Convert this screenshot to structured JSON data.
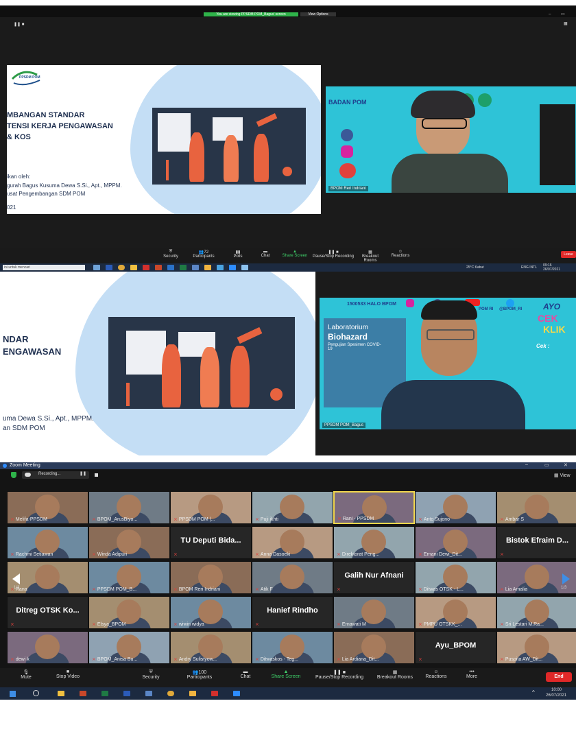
{
  "panel1": {
    "viewing_banner": "You are viewing PPSDM POM_Bagus' screen",
    "view_options": "View Options",
    "slide": {
      "logo_text": "PPSDM POM",
      "title_lines": [
        "MBANGAN STANDAR",
        "TENSI KERJA PENGAWASAN",
        "& KOS"
      ],
      "presented_by": "ikan oleh:",
      "presenter_line1": "gurah Bagus Kusuma Dewa S.Si., Apt., MPPM.",
      "presenter_line2": "usat Pengembangan SDM POM",
      "year": "021"
    },
    "speaker": {
      "name": "BPOM Reri Indriani",
      "banner_label": "BADAN POM"
    },
    "toolbar": {
      "participants_count": "72",
      "items": [
        "Security",
        "Participants",
        "Polls",
        "Chat",
        "Share Screen",
        "Pause/Stop Recording",
        "Breakout Rooms",
        "Reactions"
      ],
      "leave": "Leave"
    },
    "taskbar": {
      "search": "ini untuk mencari",
      "weather": "25°C Kabut",
      "lang": "ENG INTL",
      "time": "09:16",
      "date": "26/07/2021"
    }
  },
  "panel2": {
    "slide": {
      "title_lines": [
        "NDAR",
        "ENGAWASAN"
      ],
      "presenter_line1": "uma Dewa S.Si., Apt., MPPM.",
      "presenter_line2": "an SDM POM"
    },
    "speaker": {
      "name": "PPSDM POM_Bagus",
      "halo_label": "1500533 HALO BPOM",
      "lab_title": "Laboratorium",
      "lab_title2": "Biohazard",
      "lab_sub": "Pengujian Spesimen COVID-19",
      "social": "POM RI",
      "social2": "@BPOM_RI",
      "ayo": "AYO",
      "cek": "CEK",
      "klik": "KLIK",
      "cek_list_header": "Cek :"
    }
  },
  "panel3": {
    "window_title": "Zoom Meeting",
    "recording": "Recording...",
    "view_label": "View",
    "page_left": "1/3",
    "page_right": "1/3",
    "tiles": [
      {
        "name": "Melifa-PPSDM",
        "type": "photo"
      },
      {
        "name": "BPOM_ArusBiyo...",
        "type": "photo"
      },
      {
        "name": "PPSDM POM |...",
        "type": "photo"
      },
      {
        "name": "Puji ikhti",
        "type": "photo"
      },
      {
        "name": "Rani - PPSDM",
        "type": "photo",
        "active": true
      },
      {
        "name": "Anto Sujono",
        "type": "photo"
      },
      {
        "name": "Ambar S",
        "type": "photo"
      },
      {
        "name": "Rachmi Setiawan",
        "type": "photo"
      },
      {
        "name": "Winda Adipuri",
        "type": "photo"
      },
      {
        "name": "TU Deputi Bida...",
        "type": "name"
      },
      {
        "name": "Anna Dasoeki",
        "type": "photo"
      },
      {
        "name": "Direktorat Peng...",
        "type": "photo"
      },
      {
        "name": "Ernani Dewi_Dit...",
        "type": "photo"
      },
      {
        "name": "Bistok Efraim D...",
        "type": "name"
      },
      {
        "name": "Rana",
        "type": "photo"
      },
      {
        "name": "PPSDM POM_B...",
        "type": "photo"
      },
      {
        "name": "BPOM Reri Indriani",
        "type": "photo"
      },
      {
        "name": "Atik F",
        "type": "photo"
      },
      {
        "name": "Galih Nur Afnani",
        "type": "name"
      },
      {
        "name": "Ditwas OTSK - L...",
        "type": "photo"
      },
      {
        "name": "Lia Amalia",
        "type": "photo"
      },
      {
        "name": "Ditreg OTSK Ko...",
        "type": "name"
      },
      {
        "name": "Elsya_BPOM",
        "type": "photo"
      },
      {
        "name": "wiwin widya",
        "type": "photo"
      },
      {
        "name": "Hanief Rindho",
        "type": "name"
      },
      {
        "name": "Ernawati M",
        "type": "photo"
      },
      {
        "name": "PMPU OTSKK_...",
        "type": "photo"
      },
      {
        "name": "Sri Lestari M.Ra...",
        "type": "photo"
      },
      {
        "name": "dewi k",
        "type": "photo"
      },
      {
        "name": "BPOM_Anisa Bu...",
        "type": "photo"
      },
      {
        "name": "Andry Sulistyow...",
        "type": "photo"
      },
      {
        "name": "Ditwaskos - Teg...",
        "type": "photo"
      },
      {
        "name": "Lia Ardiana_Dit...",
        "type": "photo"
      },
      {
        "name": "Ayu_BPOM",
        "type": "name"
      },
      {
        "name": "Puspita AW_Dit...",
        "type": "photo"
      }
    ],
    "toolbar": {
      "mute": "Mute",
      "stop_video": "Stop Video",
      "security": "Security",
      "participants": "Participants",
      "participants_count": "100",
      "chat": "Chat",
      "share_screen": "Share Screen",
      "recording": "Pause/Stop Recording",
      "breakout": "Breakout Rooms",
      "reactions": "Reactions",
      "more": "More",
      "end": "End"
    },
    "taskbar": {
      "time": "10:00",
      "date": "26/07/2021"
    }
  }
}
